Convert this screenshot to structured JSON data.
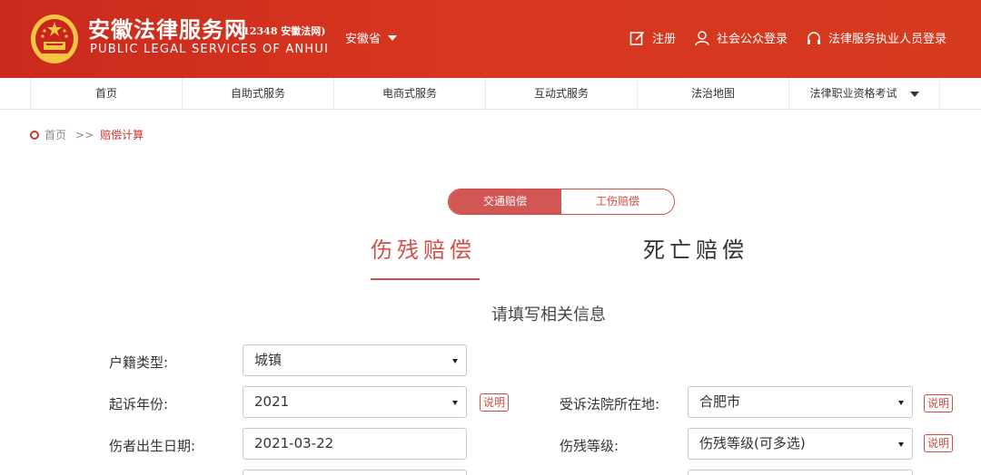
{
  "header": {
    "title": "安徽法律服务网",
    "subtitle": "(12348 安徽法网)",
    "english": "PUBLIC LEGAL SERVICES OF ANHUI",
    "province": "安徽省",
    "register": "注册",
    "public_login": "社会公众登录",
    "practitioner_login": "法律服务执业人员登录"
  },
  "nav": {
    "items": [
      "首页",
      "自助式服务",
      "电商式服务",
      "互动式服务",
      "法治地图",
      "法律职业资格考试"
    ]
  },
  "breadcrumb": {
    "home": "首页",
    "sep": ">>",
    "current": "赔偿计算"
  },
  "toggle": {
    "active": "交通赔偿",
    "inactive": "工伤赔偿"
  },
  "subtabs": {
    "active": "伤残赔偿",
    "inactive": "死亡赔偿"
  },
  "form": {
    "title": "请填写相关信息",
    "household_label": "户籍类型:",
    "household_value": "城镇",
    "year_label": "起诉年份:",
    "year_value": "2021",
    "court_label": "受诉法院所在地:",
    "court_value": "合肥市",
    "birth_label": "伤者出生日期:",
    "birth_value": "2021-03-22",
    "grade_label": "伤残等级:",
    "grade_value": "伤残等级(可多选)",
    "help": "说明"
  },
  "colors": {
    "brand": "#d2362b",
    "accent": "#d2504a"
  }
}
